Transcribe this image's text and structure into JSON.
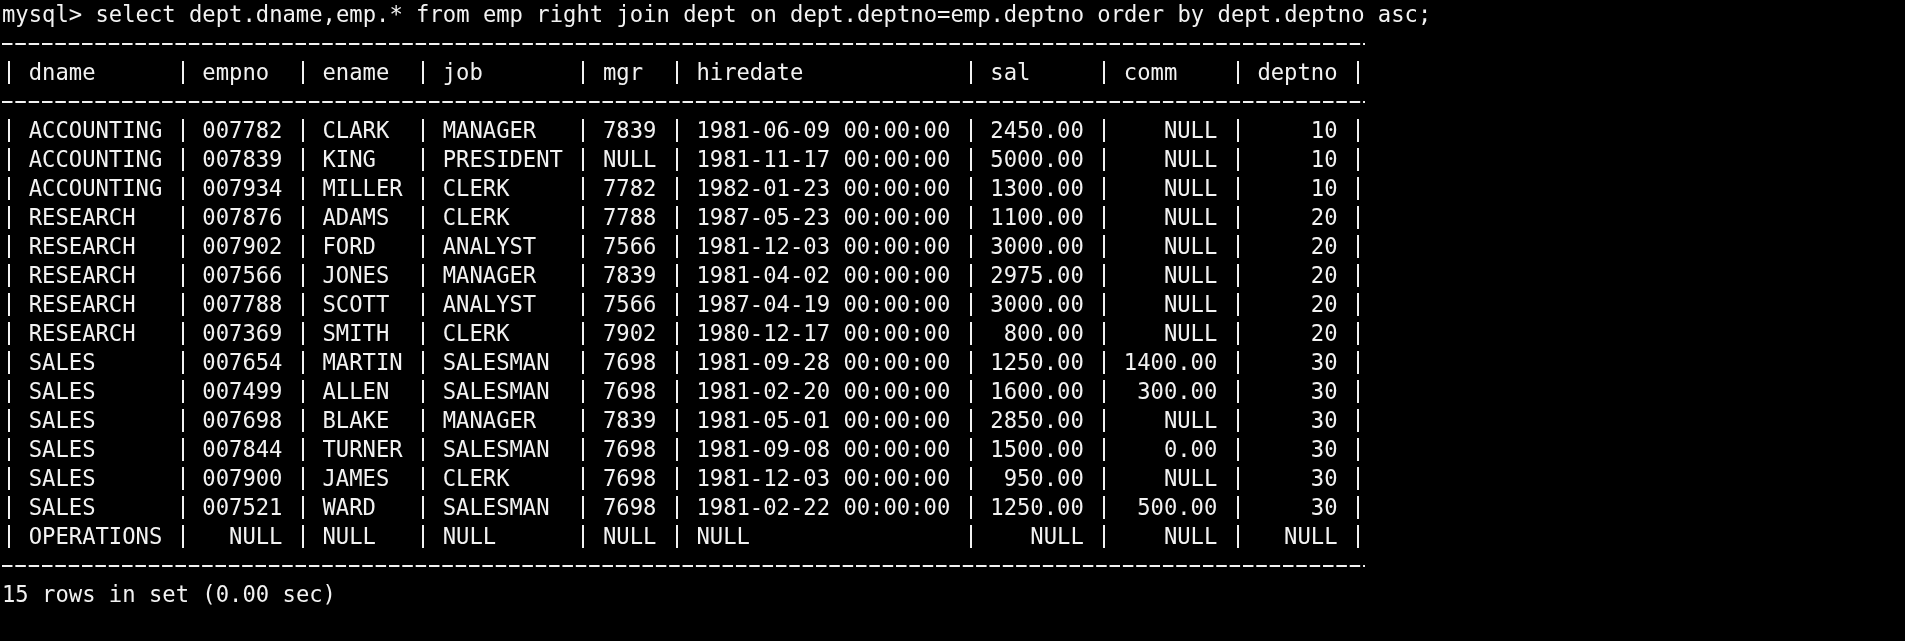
{
  "terminal": {
    "prompt": "mysql>",
    "command": "select dept.dname,emp.* from emp right join dept on dept.deptno=emp.deptno order by dept.deptno asc;",
    "table": {
      "columns": [
        {
          "name": "dname",
          "right_aligned": false
        },
        {
          "name": "empno",
          "right_aligned": true
        },
        {
          "name": "ename",
          "right_aligned": false
        },
        {
          "name": "job",
          "right_aligned": false
        },
        {
          "name": "mgr"
        },
        {
          "name": "hiredate",
          "right_aligned": false
        },
        {
          "name": "sal",
          "right_aligned": true
        },
        {
          "name": "comm",
          "right_aligned": true
        },
        {
          "name": "deptno",
          "right_aligned": true
        }
      ],
      "rows": [
        [
          "ACCOUNTING",
          "007782",
          "CLARK",
          "MANAGER",
          "7839",
          "1981-06-09 00:00:00",
          "2450.00",
          "NULL",
          "10"
        ],
        [
          "ACCOUNTING",
          "007839",
          "KING",
          "PRESIDENT",
          "NULL",
          "1981-11-17 00:00:00",
          "5000.00",
          "NULL",
          "10"
        ],
        [
          "ACCOUNTING",
          "007934",
          "MILLER",
          "CLERK",
          "7782",
          "1982-01-23 00:00:00",
          "1300.00",
          "NULL",
          "10"
        ],
        [
          "RESEARCH",
          "007876",
          "ADAMS",
          "CLERK",
          "7788",
          "1987-05-23 00:00:00",
          "1100.00",
          "NULL",
          "20"
        ],
        [
          "RESEARCH",
          "007902",
          "FORD",
          "ANALYST",
          "7566",
          "1981-12-03 00:00:00",
          "3000.00",
          "NULL",
          "20"
        ],
        [
          "RESEARCH",
          "007566",
          "JONES",
          "MANAGER",
          "7839",
          "1981-04-02 00:00:00",
          "2975.00",
          "NULL",
          "20"
        ],
        [
          "RESEARCH",
          "007788",
          "SCOTT",
          "ANALYST",
          "7566",
          "1987-04-19 00:00:00",
          "3000.00",
          "NULL",
          "20"
        ],
        [
          "RESEARCH",
          "007369",
          "SMITH",
          "CLERK",
          "7902",
          "1980-12-17 00:00:00",
          "800.00",
          "NULL",
          "20"
        ],
        [
          "SALES",
          "007654",
          "MARTIN",
          "SALESMAN",
          "7698",
          "1981-09-28 00:00:00",
          "1250.00",
          "1400.00",
          "30"
        ],
        [
          "SALES",
          "007499",
          "ALLEN",
          "SALESMAN",
          "7698",
          "1981-02-20 00:00:00",
          "1600.00",
          "300.00",
          "30"
        ],
        [
          "SALES",
          "007698",
          "BLAKE",
          "MANAGER",
          "7839",
          "1981-05-01 00:00:00",
          "2850.00",
          "NULL",
          "30"
        ],
        [
          "SALES",
          "007844",
          "TURNER",
          "SALESMAN",
          "7698",
          "1981-09-08 00:00:00",
          "1500.00",
          "0.00",
          "30"
        ],
        [
          "SALES",
          "007900",
          "JAMES",
          "CLERK",
          "7698",
          "1981-12-03 00:00:00",
          "950.00",
          "NULL",
          "30"
        ],
        [
          "SALES",
          "007521",
          "WARD",
          "SALESMAN",
          "7698",
          "1981-02-22 00:00:00",
          "1250.00",
          "500.00",
          "30"
        ],
        [
          "OPERATIONS",
          "NULL",
          "NULL",
          "NULL",
          "NULL",
          "NULL",
          "NULL",
          "NULL",
          "NULL"
        ]
      ]
    },
    "result_summary": "15 rows in set (0.00 sec)"
  }
}
